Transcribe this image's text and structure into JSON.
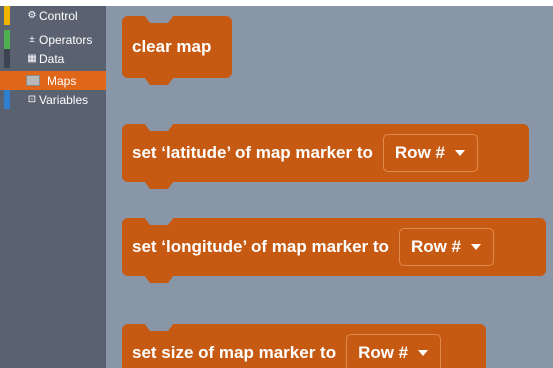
{
  "sidebar": {
    "items": [
      {
        "label": "Control",
        "icon": "gear-icon",
        "glyph": "⚙",
        "stripe": "#f0b400",
        "selected": false
      },
      {
        "label": "Operators",
        "icon": "plus-minus-icon",
        "glyph": "±",
        "stripe": "#4caf50",
        "selected": false
      },
      {
        "label": "Data",
        "icon": "table-icon",
        "glyph": "▦",
        "stripe": "#3d4350",
        "selected": false
      },
      {
        "label": "Maps",
        "icon": "map-icon",
        "glyph": "",
        "stripe": "#e0671a",
        "selected": true
      },
      {
        "label": "Variables",
        "icon": "variable-box-icon",
        "glyph": "⊡",
        "stripe": "#2f7fd0",
        "selected": false
      }
    ]
  },
  "blocks": {
    "clear_map": {
      "text": "clear map"
    },
    "set_latitude": {
      "text": "set ‘latitude’ of map marker to",
      "dropdown": "Row #"
    },
    "set_longitude": {
      "text": "set ‘longitude’ of map marker to",
      "dropdown": "Row #"
    },
    "set_size": {
      "text": "set size of map marker to",
      "dropdown": "Row #"
    }
  },
  "colors": {
    "block": "#c75a12",
    "workspace": "#8896a8",
    "sidebar": "#5a6272",
    "selected": "#e0671a"
  }
}
